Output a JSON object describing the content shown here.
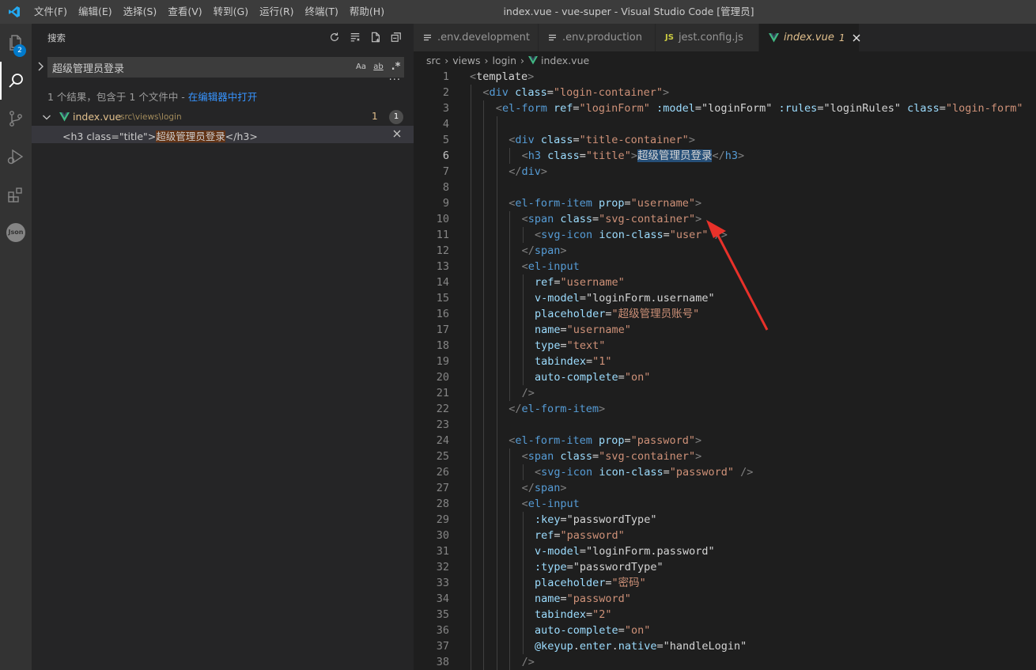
{
  "window": {
    "title": "index.vue - vue-super - Visual Studio Code [管理员]",
    "menu": [
      "文件(F)",
      "编辑(E)",
      "选择(S)",
      "查看(V)",
      "转到(G)",
      "运行(R)",
      "终端(T)",
      "帮助(H)"
    ]
  },
  "activity_bar": {
    "items": [
      {
        "name": "explorer-icon",
        "badge": "2"
      },
      {
        "name": "search-icon",
        "active": true
      },
      {
        "name": "source-control-icon"
      },
      {
        "name": "run-debug-icon"
      },
      {
        "name": "extensions-icon"
      },
      {
        "name": "json-icon",
        "label": "Json"
      }
    ]
  },
  "sidebar": {
    "title": "搜索",
    "search_value": "超级管理员登录",
    "options": {
      "match_case": "Aa",
      "whole_word": "ab",
      "regex": ".*"
    },
    "more": "···",
    "summary_prefix": "1 个结果，包含于 1 个文件中 - ",
    "summary_link": "在编辑器中打开",
    "file": {
      "name": "index.vue",
      "path": "src\\views\\login",
      "problems": "1",
      "matches": "1"
    },
    "match": {
      "before": "<h3 class=\"title\">",
      "highlight": "超级管理员登录",
      "after": "</h3>"
    }
  },
  "tabs": [
    {
      "label": ".env.development",
      "icon": "lines",
      "dirty": true
    },
    {
      "label": ".env.production",
      "icon": "lines",
      "dirty": true
    },
    {
      "label": "jest.config.js",
      "icon": "js",
      "icon_text": "JS",
      "dirty": false
    },
    {
      "label": "index.vue",
      "icon": "vue",
      "badge": "1",
      "active": true
    }
  ],
  "breadcrumb": [
    "src",
    "views",
    "login",
    "index.vue"
  ],
  "editor": {
    "current_line": 6,
    "lines": [
      {
        "n": "1",
        "indent": 0,
        "html": "<span class=\"p\">&lt;</span><span class=\"d\">template</span><span class=\"p\">&gt;</span>"
      },
      {
        "n": "2",
        "indent": 1,
        "html": "<span class=\"p\">&lt;</span><span class=\"t\">div</span> <span class=\"a\">class</span>=<span class=\"s\">\"login-container\"</span><span class=\"p\">&gt;</span>"
      },
      {
        "n": "3",
        "indent": 2,
        "html": "<span class=\"p\">&lt;</span><span class=\"t\">el-form</span> <span class=\"a\">ref</span>=<span class=\"s\">\"loginForm\"</span> <span class=\"a\">:model</span>=<span class=\"w\">\"loginForm\"</span> <span class=\"a\">:rules</span>=<span class=\"w\">\"loginRules\"</span> <span class=\"a\">class</span>=<span class=\"s\">\"login-form\"</span>"
      },
      {
        "n": "4",
        "indent": 3,
        "html": ""
      },
      {
        "n": "5",
        "indent": 3,
        "html": "<span class=\"p\">&lt;</span><span class=\"t\">div</span> <span class=\"a\">class</span>=<span class=\"s\">\"title-container\"</span><span class=\"p\">&gt;</span>"
      },
      {
        "n": "6",
        "indent": 4,
        "html": "<span class=\"p\">&lt;</span><span class=\"t\">h3</span> <span class=\"a\">class</span>=<span class=\"s\">\"title\"</span><span class=\"p\">&gt;</span><span class=\"sel\">超级管理员登录</span><span class=\"p\">&lt;/</span><span class=\"t\">h3</span><span class=\"p\">&gt;</span>"
      },
      {
        "n": "7",
        "indent": 3,
        "html": "<span class=\"p\">&lt;/</span><span class=\"t\">div</span><span class=\"p\">&gt;</span>"
      },
      {
        "n": "8",
        "indent": 3,
        "html": ""
      },
      {
        "n": "9",
        "indent": 3,
        "html": "<span class=\"p\">&lt;</span><span class=\"t\">el-form-item</span> <span class=\"a\">prop</span>=<span class=\"s\">\"username\"</span><span class=\"p\">&gt;</span>"
      },
      {
        "n": "10",
        "indent": 4,
        "html": "<span class=\"p\">&lt;</span><span class=\"t\">span</span> <span class=\"a\">class</span>=<span class=\"s\">\"svg-container\"</span><span class=\"p\">&gt;</span>"
      },
      {
        "n": "11",
        "indent": 5,
        "html": "<span class=\"p\">&lt;</span><span class=\"t\">svg-icon</span> <span class=\"a\">icon-class</span>=<span class=\"s\">\"user\"</span> <span class=\"p\">/&gt;</span>"
      },
      {
        "n": "12",
        "indent": 4,
        "html": "<span class=\"p\">&lt;/</span><span class=\"t\">span</span><span class=\"p\">&gt;</span>"
      },
      {
        "n": "13",
        "indent": 4,
        "html": "<span class=\"p\">&lt;</span><span class=\"t\">el-input</span>"
      },
      {
        "n": "14",
        "indent": 5,
        "html": "<span class=\"a\">ref</span>=<span class=\"s\">\"username\"</span>"
      },
      {
        "n": "15",
        "indent": 5,
        "html": "<span class=\"a\">v-model</span>=<span class=\"w\">\"loginForm.username\"</span>"
      },
      {
        "n": "16",
        "indent": 5,
        "html": "<span class=\"a\">placeholder</span>=<span class=\"s\">\"超级管理员账号\"</span>"
      },
      {
        "n": "17",
        "indent": 5,
        "html": "<span class=\"a\">name</span>=<span class=\"s\">\"username\"</span>"
      },
      {
        "n": "18",
        "indent": 5,
        "html": "<span class=\"a\">type</span>=<span class=\"s\">\"text\"</span>"
      },
      {
        "n": "19",
        "indent": 5,
        "html": "<span class=\"a\">tabindex</span>=<span class=\"s\">\"1\"</span>"
      },
      {
        "n": "20",
        "indent": 5,
        "html": "<span class=\"a\">auto-complete</span>=<span class=\"s\">\"on\"</span>"
      },
      {
        "n": "21",
        "indent": 4,
        "html": "<span class=\"p\">/&gt;</span>"
      },
      {
        "n": "22",
        "indent": 3,
        "html": "<span class=\"p\">&lt;/</span><span class=\"t\">el-form-item</span><span class=\"p\">&gt;</span>"
      },
      {
        "n": "23",
        "indent": 3,
        "html": ""
      },
      {
        "n": "24",
        "indent": 3,
        "html": "<span class=\"p\">&lt;</span><span class=\"t\">el-form-item</span> <span class=\"a\">prop</span>=<span class=\"s\">\"password\"</span><span class=\"p\">&gt;</span>"
      },
      {
        "n": "25",
        "indent": 4,
        "html": "<span class=\"p\">&lt;</span><span class=\"t\">span</span> <span class=\"a\">class</span>=<span class=\"s\">\"svg-container\"</span><span class=\"p\">&gt;</span>"
      },
      {
        "n": "26",
        "indent": 5,
        "html": "<span class=\"p\">&lt;</span><span class=\"t\">svg-icon</span> <span class=\"a\">icon-class</span>=<span class=\"s\">\"password\"</span> <span class=\"p\">/&gt;</span>"
      },
      {
        "n": "27",
        "indent": 4,
        "html": "<span class=\"p\">&lt;/</span><span class=\"t\">span</span><span class=\"p\">&gt;</span>"
      },
      {
        "n": "28",
        "indent": 4,
        "html": "<span class=\"p\">&lt;</span><span class=\"t\">el-input</span>"
      },
      {
        "n": "29",
        "indent": 5,
        "html": "<span class=\"a\">:key</span>=<span class=\"w\">\"passwordType\"</span>"
      },
      {
        "n": "30",
        "indent": 5,
        "html": "<span class=\"a\">ref</span>=<span class=\"s\">\"password\"</span>"
      },
      {
        "n": "31",
        "indent": 5,
        "html": "<span class=\"a\">v-model</span>=<span class=\"w\">\"loginForm.password\"</span>"
      },
      {
        "n": "32",
        "indent": 5,
        "html": "<span class=\"a\">:type</span>=<span class=\"w\">\"passwordType\"</span>"
      },
      {
        "n": "33",
        "indent": 5,
        "html": "<span class=\"a\">placeholder</span>=<span class=\"s\">\"密码\"</span>"
      },
      {
        "n": "34",
        "indent": 5,
        "html": "<span class=\"a\">name</span>=<span class=\"s\">\"password\"</span>"
      },
      {
        "n": "35",
        "indent": 5,
        "html": "<span class=\"a\">tabindex</span>=<span class=\"s\">\"2\"</span>"
      },
      {
        "n": "36",
        "indent": 5,
        "html": "<span class=\"a\">auto-complete</span>=<span class=\"s\">\"on\"</span>"
      },
      {
        "n": "37",
        "indent": 5,
        "html": "<span class=\"a\">@keyup</span>.<span class=\"a\">enter</span>.<span class=\"a\">native</span>=<span class=\"w\">\"handleLogin\"</span>"
      },
      {
        "n": "38",
        "indent": 4,
        "html": "<span class=\"p\">/&gt;</span>"
      }
    ]
  },
  "colors": {
    "accent": "#007acc",
    "annotation_arrow": "#e8312a",
    "modified_file": "#e2c08d",
    "link": "#3794ff"
  }
}
